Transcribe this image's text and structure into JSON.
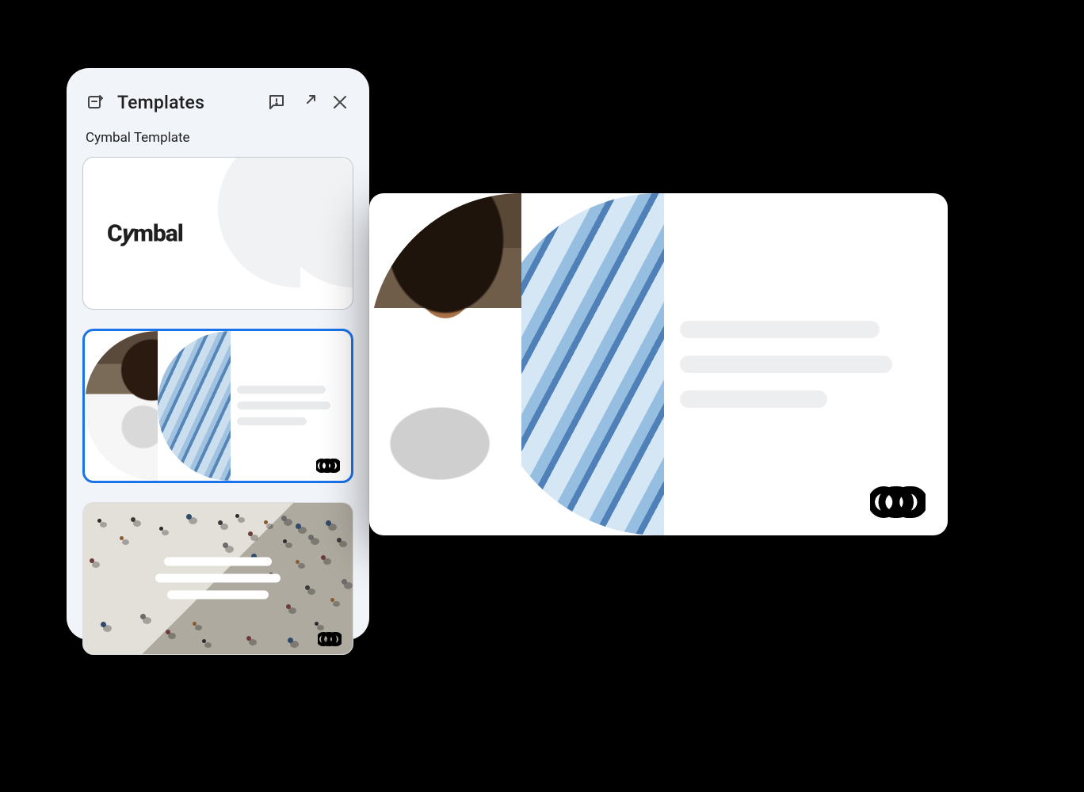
{
  "panel": {
    "title": "Templates",
    "section_label": "Cymbal Template",
    "icons": {
      "theme": "theme-builder-icon",
      "feedback": "feedback-icon",
      "expand": "expand-icon",
      "close": "close-icon"
    }
  },
  "templates": [
    {
      "id": "cymbal-title",
      "brand_word": "Cymbal",
      "selected": false
    },
    {
      "id": "cymbal-content",
      "selected": true
    },
    {
      "id": "cymbal-aerial",
      "selected": false
    }
  ],
  "brand": {
    "word": "Cymbal",
    "mark": "cymbal-mark"
  },
  "colors": {
    "panel_bg": "#f1f4f9",
    "select_border": "#1a73e8",
    "placeholder": "#eceeef"
  }
}
